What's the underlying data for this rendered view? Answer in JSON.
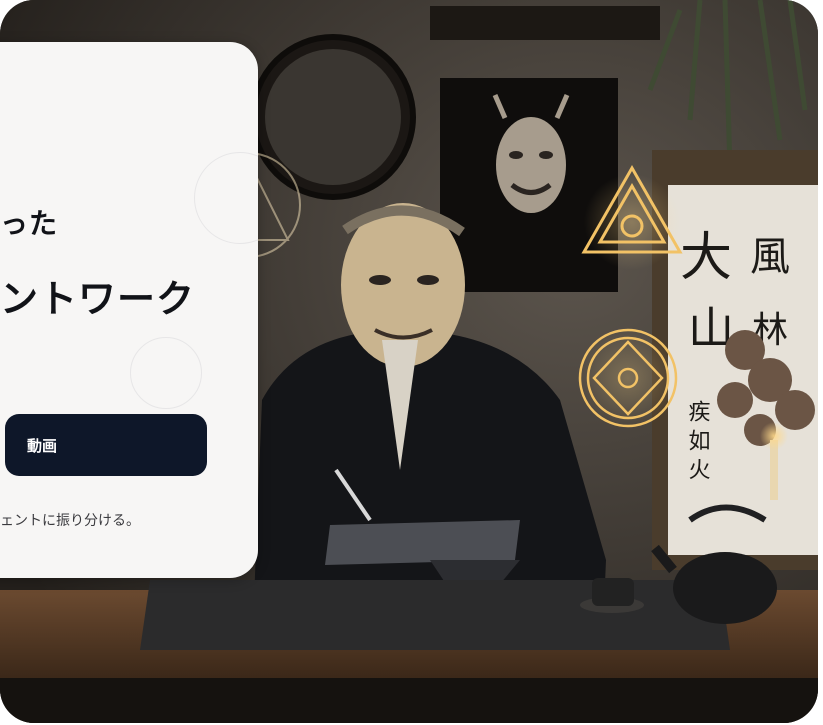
{
  "hero": {
    "title_line1": "った",
    "title_line2": "ントワーク",
    "video_button_label": "動画",
    "subtext": "ェントに振り分ける。"
  },
  "scene": {
    "calligraphy_chars": [
      "大",
      "風",
      "山",
      "林"
    ],
    "calligraphy_small": "疾 如 火"
  },
  "colors": {
    "card_background": "#f7f6f5",
    "button_background": "#0e1729",
    "glyph_gold": "#f2c266"
  }
}
